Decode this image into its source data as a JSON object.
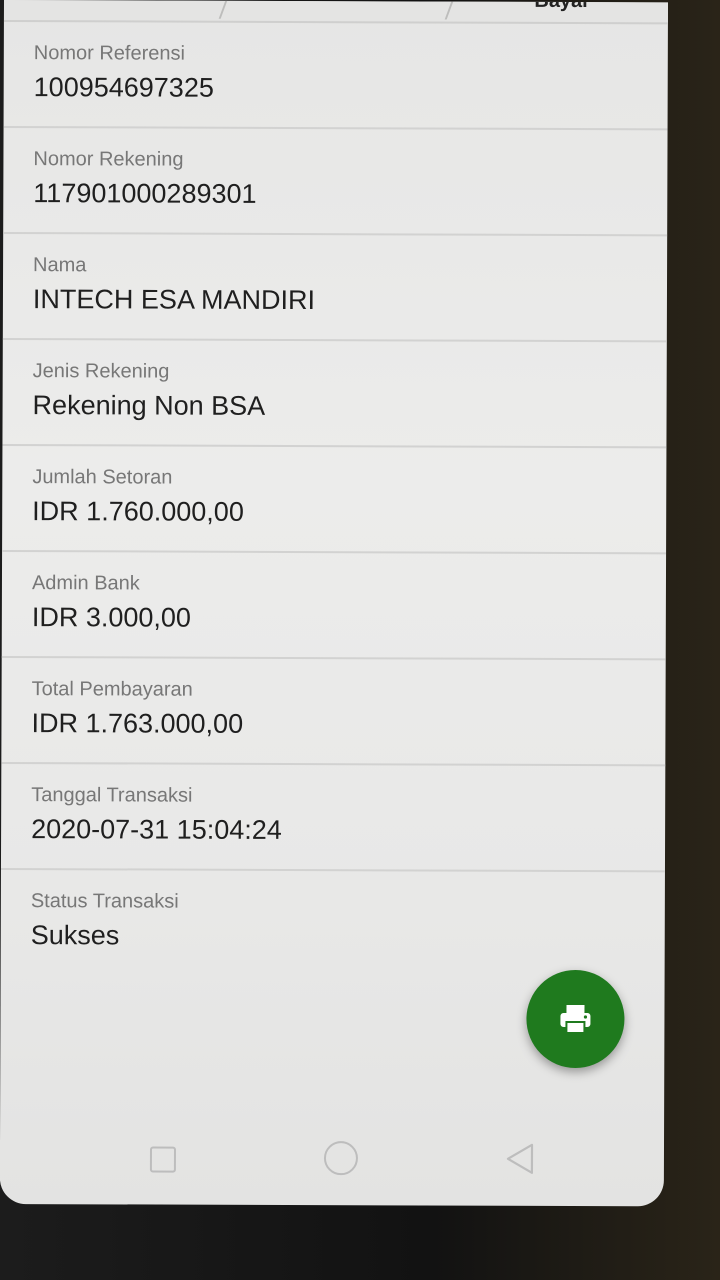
{
  "header": {
    "partial_tab_label": "Bayar"
  },
  "details": [
    {
      "label": "Nomor Referensi",
      "value": "100954697325"
    },
    {
      "label": "Nomor Rekening",
      "value": "117901000289301"
    },
    {
      "label": "Nama",
      "value": "INTECH ESA MANDIRI"
    },
    {
      "label": "Jenis Rekening",
      "value": "Rekening Non BSA"
    },
    {
      "label": "Jumlah Setoran",
      "value": "IDR 1.760.000,00"
    },
    {
      "label": "Admin Bank",
      "value": "IDR 3.000,00"
    },
    {
      "label": "Total Pembayaran",
      "value": "IDR 1.763.000,00"
    },
    {
      "label": "Tanggal Transaksi",
      "value": "2020-07-31 15:04:24"
    },
    {
      "label": "Status Transaksi",
      "value": "Sukses"
    }
  ],
  "fab": {
    "icon": "printer-icon",
    "color": "#1f7a1e"
  },
  "navbar": {
    "icons": [
      "recent-apps-icon",
      "home-icon",
      "back-icon"
    ]
  }
}
